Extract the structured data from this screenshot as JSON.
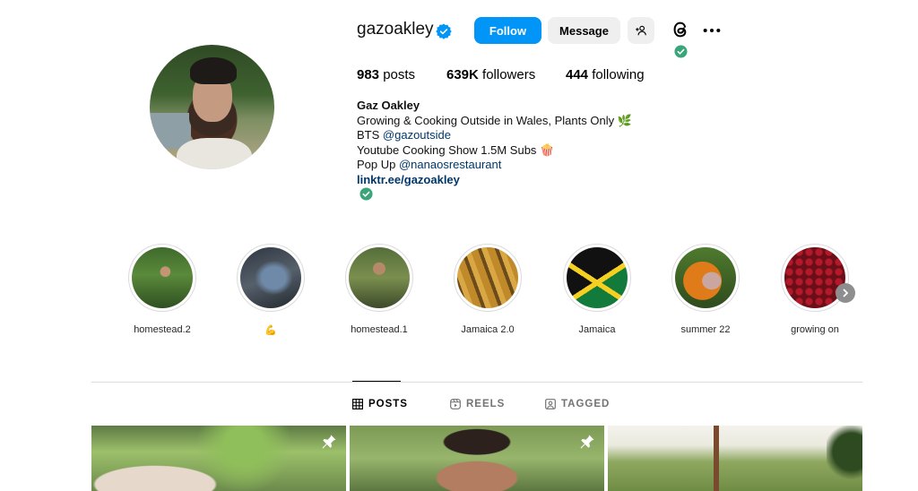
{
  "profile": {
    "username": "gazoakley",
    "follow_label": "Follow",
    "message_label": "Message",
    "stats": {
      "posts_count": "983",
      "posts_label": "posts",
      "followers_count": "639K",
      "followers_label": "followers",
      "following_count": "444",
      "following_label": "following"
    },
    "bio": {
      "name": "Gaz Oakley",
      "line1": "Growing & Cooking Outside in Wales, Plants Only 🌿",
      "line2_prefix": "BTS ",
      "line2_mention": "@gazoutside",
      "line3": "Youtube Cooking Show 1.5M Subs 🍿",
      "line4_prefix": "Pop Up ",
      "line4_mention": "@nanaosrestaurant",
      "link": "linktr.ee/gazoakley"
    }
  },
  "highlights": [
    {
      "label": "homestead.2"
    },
    {
      "label": "💪"
    },
    {
      "label": "homestead.1"
    },
    {
      "label": "Jamaica 2.0"
    },
    {
      "label": "Jamaica"
    },
    {
      "label": "summer 22"
    },
    {
      "label": "growing on"
    }
  ],
  "tabs": [
    {
      "label": "POSTS",
      "icon": "grid-icon",
      "active": true
    },
    {
      "label": "REELS",
      "icon": "reels-icon",
      "active": false
    },
    {
      "label": "TAGGED",
      "icon": "tagged-icon",
      "active": false
    }
  ],
  "colors": {
    "accent": "#0095f6",
    "verified": "#0095f6",
    "link": "#00376b",
    "threads_check": "#3aa57a"
  }
}
